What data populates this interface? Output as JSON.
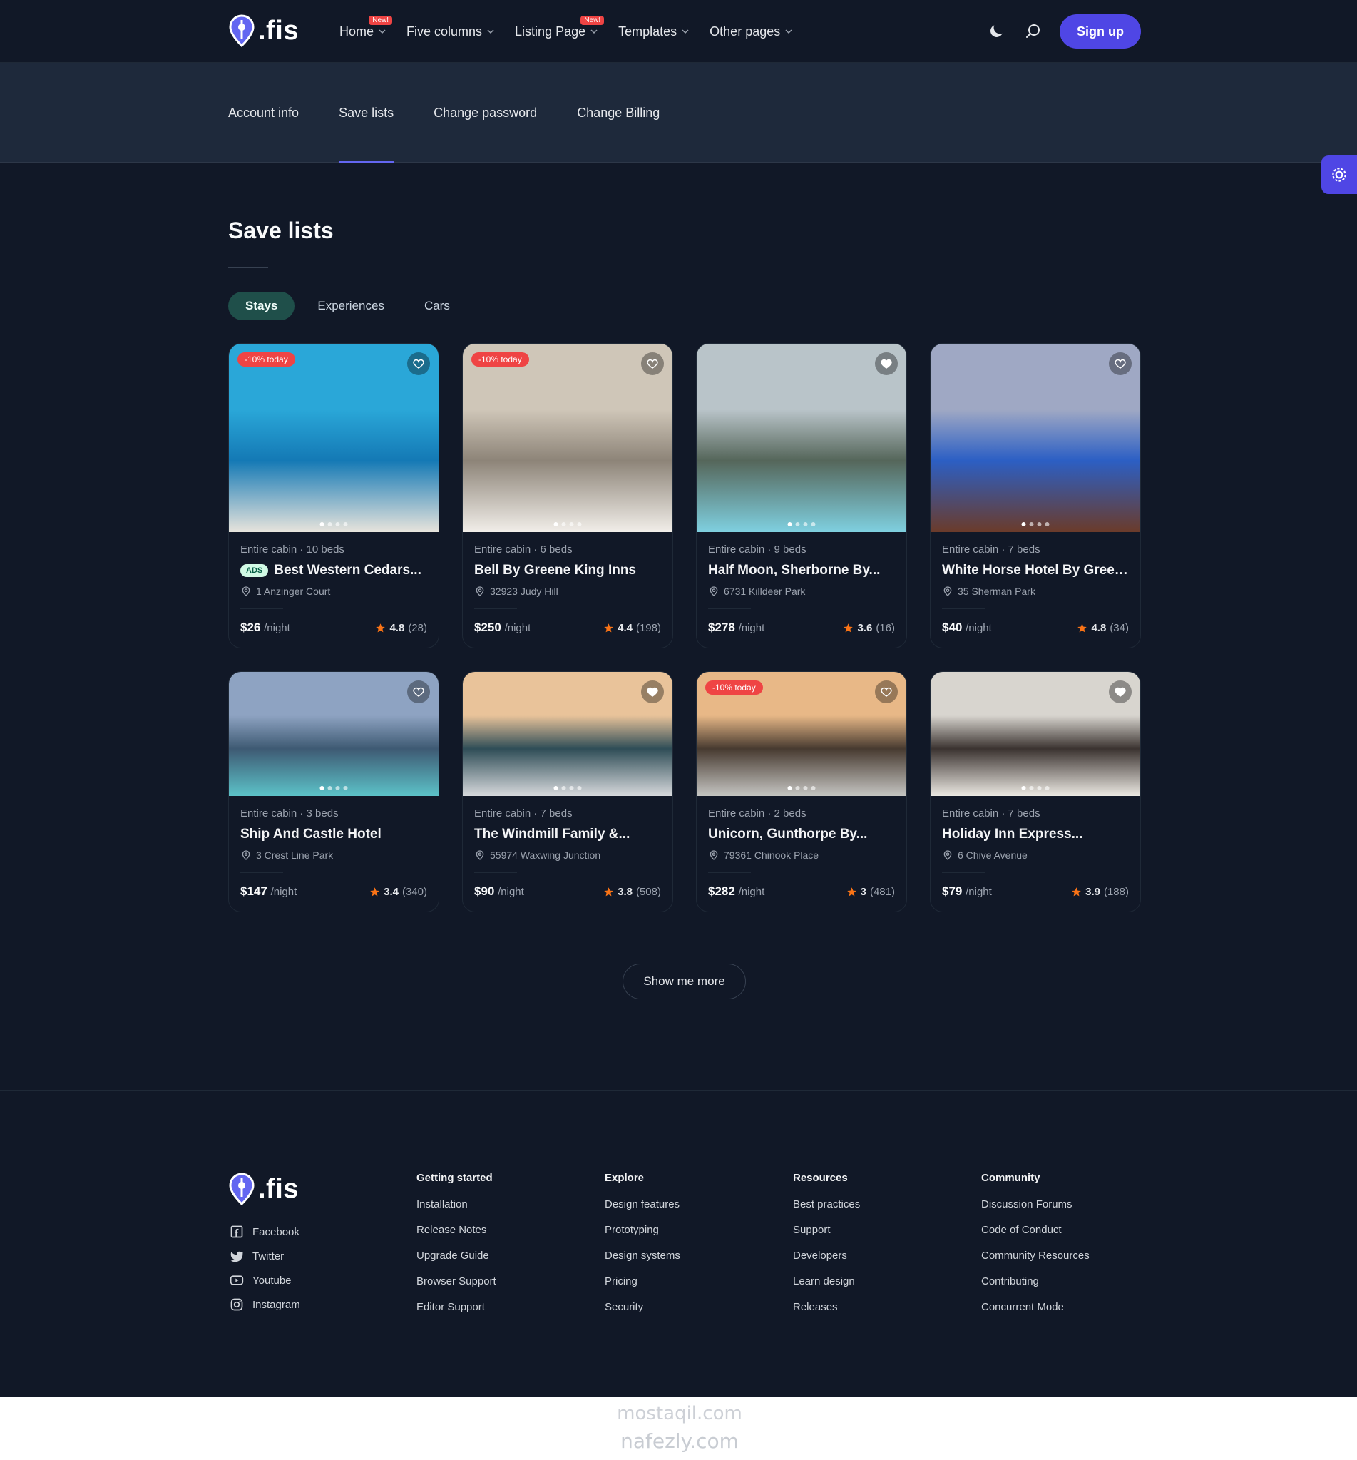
{
  "brand": {
    "name": ".fis"
  },
  "nav": [
    {
      "label": "Home",
      "badge": "New!",
      "has_dropdown": true
    },
    {
      "label": "Five columns",
      "badge": "",
      "has_dropdown": true
    },
    {
      "label": "Listing Page",
      "badge": "New!",
      "has_dropdown": true
    },
    {
      "label": "Templates",
      "badge": "",
      "has_dropdown": true
    },
    {
      "label": "Other pages",
      "badge": "",
      "has_dropdown": true
    }
  ],
  "header": {
    "signup_label": "Sign up",
    "icons": [
      "moon-icon",
      "search-icon"
    ]
  },
  "account_tabs": [
    {
      "label": "Account info",
      "active": false
    },
    {
      "label": "Save lists",
      "active": true
    },
    {
      "label": "Change password",
      "active": false
    },
    {
      "label": "Change Billing",
      "active": false
    }
  ],
  "page": {
    "title": "Save lists",
    "show_more_label": "Show me more"
  },
  "filters": [
    {
      "label": "Stays",
      "active": true
    },
    {
      "label": "Experiences",
      "active": false
    },
    {
      "label": "Cars",
      "active": false
    }
  ],
  "listings": [
    {
      "meta": "Entire cabin · 10 beds",
      "ads": "ADS",
      "name": "Best Western Cedars...",
      "address": "1 Anzinger Court",
      "price": "$26",
      "per": "/night",
      "rating": "4.8",
      "reviews": "(28)",
      "discount": "-10% today",
      "liked": false,
      "colors": [
        "#2aa7d8",
        "#1479b5",
        "#e8e4dc"
      ]
    },
    {
      "meta": "Entire cabin · 6 beds",
      "ads": "",
      "name": "Bell By Greene King Inns",
      "address": "32923 Judy Hill",
      "price": "$250",
      "per": "/night",
      "rating": "4.4",
      "reviews": "(198)",
      "discount": "-10% today",
      "liked": false,
      "colors": [
        "#cfc6b8",
        "#8d8478",
        "#f1eee9"
      ]
    },
    {
      "meta": "Entire cabin · 9 beds",
      "ads": "",
      "name": "Half Moon, Sherborne By...",
      "address": "6731 Killdeer Park",
      "price": "$278",
      "per": "/night",
      "rating": "3.6",
      "reviews": "(16)",
      "discount": "",
      "liked": true,
      "colors": [
        "#b9c4c9",
        "#55665a",
        "#7fd0e0"
      ]
    },
    {
      "meta": "Entire cabin · 7 beds",
      "ads": "",
      "name": "White Horse Hotel By Green...",
      "address": "35 Sherman Park",
      "price": "$40",
      "per": "/night",
      "rating": "4.8",
      "reviews": "(34)",
      "discount": "",
      "liked": false,
      "colors": [
        "#9fa8c4",
        "#2c5fc4",
        "#6b3b2a"
      ]
    },
    {
      "meta": "Entire cabin · 3 beds",
      "ads": "",
      "name": "Ship And Castle Hotel",
      "address": "3 Crest Line Park",
      "price": "$147",
      "per": "/night",
      "rating": "3.4",
      "reviews": "(340)",
      "discount": "",
      "liked": false,
      "colors": [
        "#8ea3c2",
        "#3e5a73",
        "#5cc2c8"
      ]
    },
    {
      "meta": "Entire cabin · 7 beds",
      "ads": "",
      "name": "The Windmill Family &...",
      "address": "55974 Waxwing Junction",
      "price": "$90",
      "per": "/night",
      "rating": "3.8",
      "reviews": "(508)",
      "discount": "",
      "liked": true,
      "colors": [
        "#e9c39a",
        "#2f4d57",
        "#d7d9dc"
      ]
    },
    {
      "meta": "Entire cabin · 2 beds",
      "ads": "",
      "name": "Unicorn, Gunthorpe By...",
      "address": "79361 Chinook Place",
      "price": "$282",
      "per": "/night",
      "rating": "3",
      "reviews": "(481)",
      "discount": "-10% today",
      "liked": false,
      "colors": [
        "#e8b887",
        "#473a30",
        "#c5c5c2"
      ]
    },
    {
      "meta": "Entire cabin · 7 beds",
      "ads": "",
      "name": "Holiday Inn Express...",
      "address": "6 Chive Avenue",
      "price": "$79",
      "per": "/night",
      "rating": "3.9",
      "reviews": "(188)",
      "discount": "",
      "liked": true,
      "colors": [
        "#d8d5cf",
        "#3b3330",
        "#ece9e3"
      ]
    }
  ],
  "footer": {
    "social": [
      {
        "label": "Facebook",
        "icon": "facebook-icon"
      },
      {
        "label": "Twitter",
        "icon": "twitter-icon"
      },
      {
        "label": "Youtube",
        "icon": "youtube-icon"
      },
      {
        "label": "Instagram",
        "icon": "instagram-icon"
      }
    ],
    "columns": [
      {
        "heading": "Getting started",
        "links": [
          "Installation",
          "Release Notes",
          "Upgrade Guide",
          "Browser Support",
          "Editor Support"
        ]
      },
      {
        "heading": "Explore",
        "links": [
          "Design features",
          "Prototyping",
          "Design systems",
          "Pricing",
          "Security"
        ]
      },
      {
        "heading": "Resources",
        "links": [
          "Best practices",
          "Support",
          "Developers",
          "Learn design",
          "Releases"
        ]
      },
      {
        "heading": "Community",
        "links": [
          "Discussion Forums",
          "Code of Conduct",
          "Community Resources",
          "Contributing",
          "Concurrent Mode"
        ]
      }
    ]
  },
  "watermark": {
    "line1": "mostaqil.com",
    "line2": "nafezly.com"
  },
  "theme": {
    "bg": "#111827",
    "accent": "#4f46e5",
    "star": "#f97316",
    "badge": "#ef4444"
  }
}
